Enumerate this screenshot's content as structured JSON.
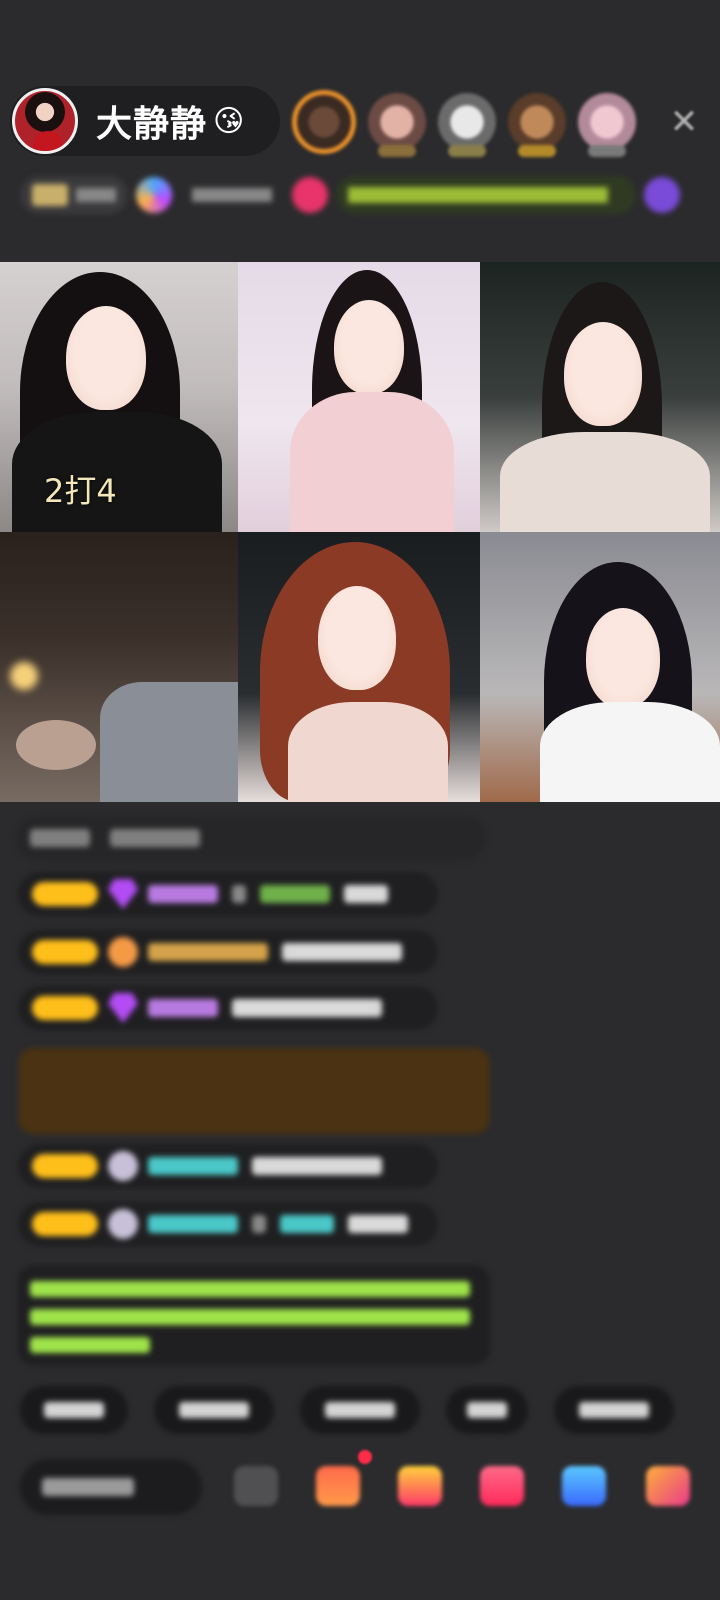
{
  "header": {
    "host_name": "大静静",
    "host_emoji": "😘",
    "close_icon": "close-icon",
    "viewer_avatars": [
      {
        "accent": "#e7902a"
      },
      {
        "accent": "#c9a3a3"
      },
      {
        "accent": "#c7c7c7"
      },
      {
        "accent": "#e7902a"
      },
      {
        "accent": "#d8b1c8"
      }
    ]
  },
  "video_grid": {
    "tiles": [
      {
        "label": "2打4"
      },
      {
        "label": ""
      },
      {
        "label": ""
      },
      {
        "label": ""
      },
      {
        "label": ""
      },
      {
        "label": ""
      }
    ]
  },
  "colors": {
    "background": "#2b2b2d",
    "level_badge": "#ffbf1a",
    "system_message_bg": "#4a3212",
    "green_text": "#9fe34a",
    "notification": "#ff2d4a"
  },
  "icons": [
    "close-icon",
    "emoji-icon",
    "gift-box-icon",
    "gift-icon",
    "heart-icon",
    "game-controller-icon",
    "more-grid-icon"
  ]
}
